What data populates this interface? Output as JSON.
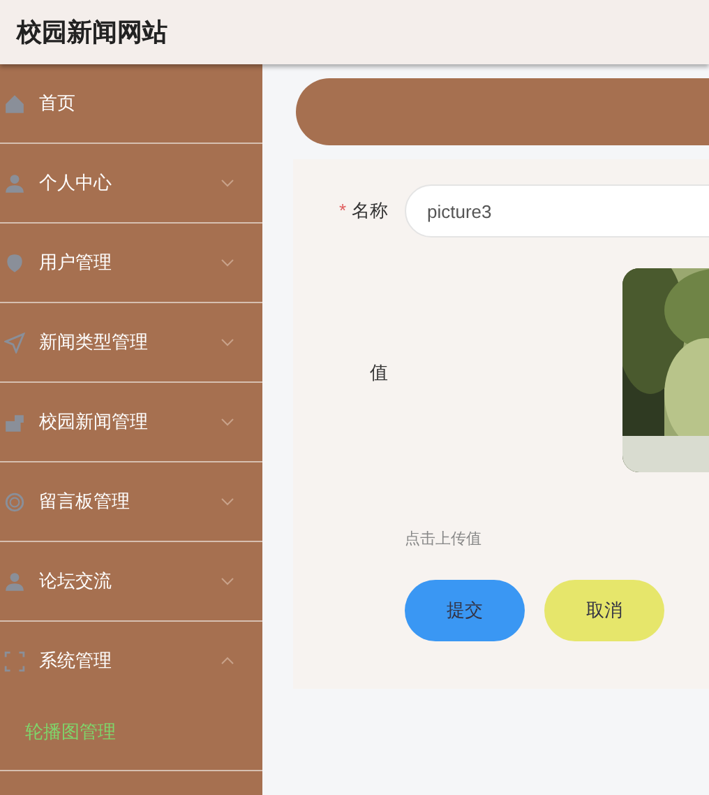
{
  "header": {
    "title": "校园新闻网站"
  },
  "sidebar": {
    "items": [
      {
        "label": "首页",
        "kind": "link"
      },
      {
        "label": "个人中心",
        "kind": "menu",
        "expanded": false
      },
      {
        "label": "用户管理",
        "kind": "menu",
        "expanded": false
      },
      {
        "label": "新闻类型管理",
        "kind": "menu",
        "expanded": false
      },
      {
        "label": "校园新闻管理",
        "kind": "menu",
        "expanded": false
      },
      {
        "label": "留言板管理",
        "kind": "menu",
        "expanded": false
      },
      {
        "label": "论坛交流",
        "kind": "menu",
        "expanded": false
      },
      {
        "label": "系统管理",
        "kind": "menu",
        "expanded": true,
        "children": [
          {
            "label": "轮播图管理",
            "selected": true
          }
        ]
      }
    ]
  },
  "form": {
    "fields": [
      {
        "kind": "text",
        "label": "名称",
        "required_mark": "*",
        "value": "picture3"
      },
      {
        "label": "值",
        "hint": "点击上传值"
      }
    ],
    "buttons": [
      {
        "label": "提交",
        "kind": "primary"
      },
      {
        "label": "取消",
        "kind": "secondary"
      }
    ]
  }
}
